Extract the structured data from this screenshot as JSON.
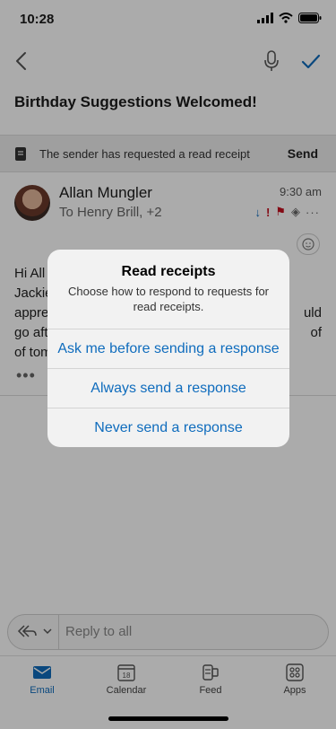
{
  "status_bar": {
    "time": "10:28"
  },
  "nav": {
    "back_icon": "chevron-left-icon",
    "mic_icon": "microphone-icon",
    "done_icon": "checkmark-icon"
  },
  "email": {
    "subject": "Birthday Suggestions Welcomed!",
    "read_receipt_banner": {
      "text": "The sender has requested a read receipt",
      "action": "Send"
    },
    "sender": {
      "name": "Allan Mungler",
      "to": "To Henry Brill, +2",
      "time": "9:30 am"
    },
    "body_lines": [
      "Hi All",
      "Jackie",
      "appre",
      "go aft",
      "of tomo"
    ],
    "body_partial_right": {
      "line3": "uld",
      "line4": "of"
    },
    "more_indicator": "•••"
  },
  "reply": {
    "placeholder": "Reply to all"
  },
  "tabs": [
    {
      "label": "Email",
      "active": true
    },
    {
      "label": "Calendar",
      "active": false
    },
    {
      "label": "Feed",
      "active": false
    },
    {
      "label": "Apps",
      "active": false
    }
  ],
  "dialog": {
    "title": "Read receipts",
    "message": "Choose how to respond to requests for read receipts.",
    "actions": [
      "Ask me before sending a response",
      "Always send a response",
      "Never send a response"
    ]
  },
  "colors": {
    "accent": "#0f6cbd",
    "flag_red": "#c50f1f",
    "overlay": "rgba(0,0,0,0.33)"
  }
}
